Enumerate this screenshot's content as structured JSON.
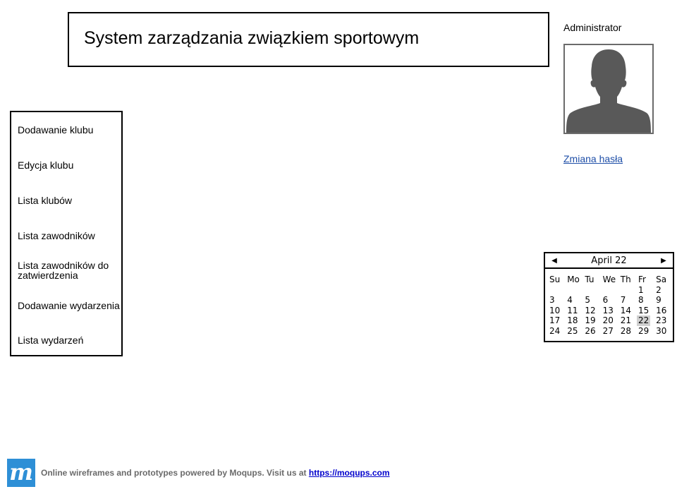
{
  "header": {
    "title": "System zarządzania związkiem sportowym"
  },
  "user": {
    "name": "Administrator",
    "avatar_icon": "user-silhouette-icon",
    "change_password_label": "Zmiana hasła"
  },
  "menu": {
    "items": [
      {
        "id": "add-club",
        "label": "Dodawanie klubu"
      },
      {
        "id": "edit-club",
        "label": "Edycja klubu"
      },
      {
        "id": "club-list",
        "label": "Lista klubów"
      },
      {
        "id": "player-list",
        "label": "Lista zawodników"
      },
      {
        "id": "players-to-approve",
        "label": "Lista zawodników do zatwierdzenia"
      },
      {
        "id": "add-event",
        "label": "Dodawanie wydarzenia"
      },
      {
        "id": "event-list",
        "label": "Lista wydarzeń"
      }
    ]
  },
  "calendar": {
    "title": "April 22",
    "prev_icon": "triangle-left-icon",
    "next_icon": "triangle-right-icon",
    "weekdays": [
      "Su",
      "Mo",
      "Tu",
      "We",
      "Th",
      "Fr",
      "Sa"
    ],
    "days": [
      "1",
      "2",
      "3",
      "4",
      "5",
      "6",
      "7",
      "8",
      "9",
      "10",
      "11",
      "12",
      "13",
      "14",
      "15",
      "16",
      "17",
      "18",
      "19",
      "20",
      "21",
      "22",
      "23",
      "24",
      "25",
      "26",
      "27",
      "28",
      "29",
      "30"
    ],
    "selected": "22"
  },
  "footer": {
    "logo_text": "m",
    "text": "Online wireframes and prototypes powered by Moqups. Visit us at",
    "link_text": "https://moqups.com"
  }
}
